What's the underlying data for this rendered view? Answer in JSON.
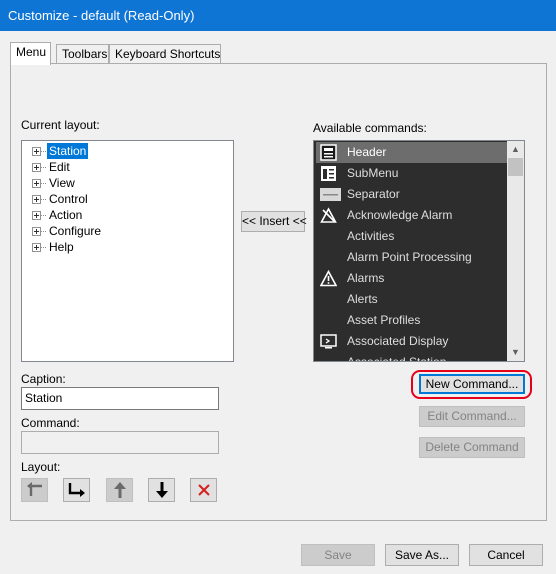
{
  "window": {
    "title": "Customize - default (Read-Only)"
  },
  "tabs": [
    {
      "label": "Menu"
    },
    {
      "label": "Toolbars"
    },
    {
      "label": "Keyboard Shortcuts"
    }
  ],
  "layout_section": {
    "label": "Current layout:",
    "items": [
      {
        "label": "Station",
        "selected": true
      },
      {
        "label": "Edit"
      },
      {
        "label": "View"
      },
      {
        "label": "Control"
      },
      {
        "label": "Action"
      },
      {
        "label": "Configure"
      },
      {
        "label": "Help"
      }
    ]
  },
  "insert_button": "<< Insert <<",
  "available_section": {
    "label": "Available commands:",
    "items": [
      {
        "label": "Header",
        "icon": "header-icon",
        "selected": true
      },
      {
        "label": "SubMenu",
        "icon": "submenu-icon"
      },
      {
        "label": "Separator",
        "icon": "separator-icon"
      },
      {
        "label": "Acknowledge Alarm",
        "icon": "acknowledge-alarm-icon"
      },
      {
        "label": "Activities",
        "icon": ""
      },
      {
        "label": "Alarm Point Processing",
        "icon": ""
      },
      {
        "label": "Alarms",
        "icon": "alarm-warning-icon"
      },
      {
        "label": "Alerts",
        "icon": ""
      },
      {
        "label": "Asset Profiles",
        "icon": ""
      },
      {
        "label": "Associated Display",
        "icon": "associated-display-icon"
      },
      {
        "label": "Associated Station",
        "icon": ""
      }
    ]
  },
  "caption": {
    "label": "Caption:",
    "value": "Station"
  },
  "command": {
    "label": "Command:",
    "value": ""
  },
  "layout_buttons": {
    "label": "Layout:"
  },
  "command_buttons": {
    "new": "New Command...",
    "edit": "Edit Command...",
    "delete": "Delete Command"
  },
  "footer": {
    "save": "Save",
    "save_as": "Save As...",
    "cancel": "Cancel"
  },
  "colors": {
    "titlebar": "#0f75d5",
    "selection": "#0078d7",
    "command_list_bg": "#2d2d2d",
    "highlight_ring": "#e8001a"
  }
}
